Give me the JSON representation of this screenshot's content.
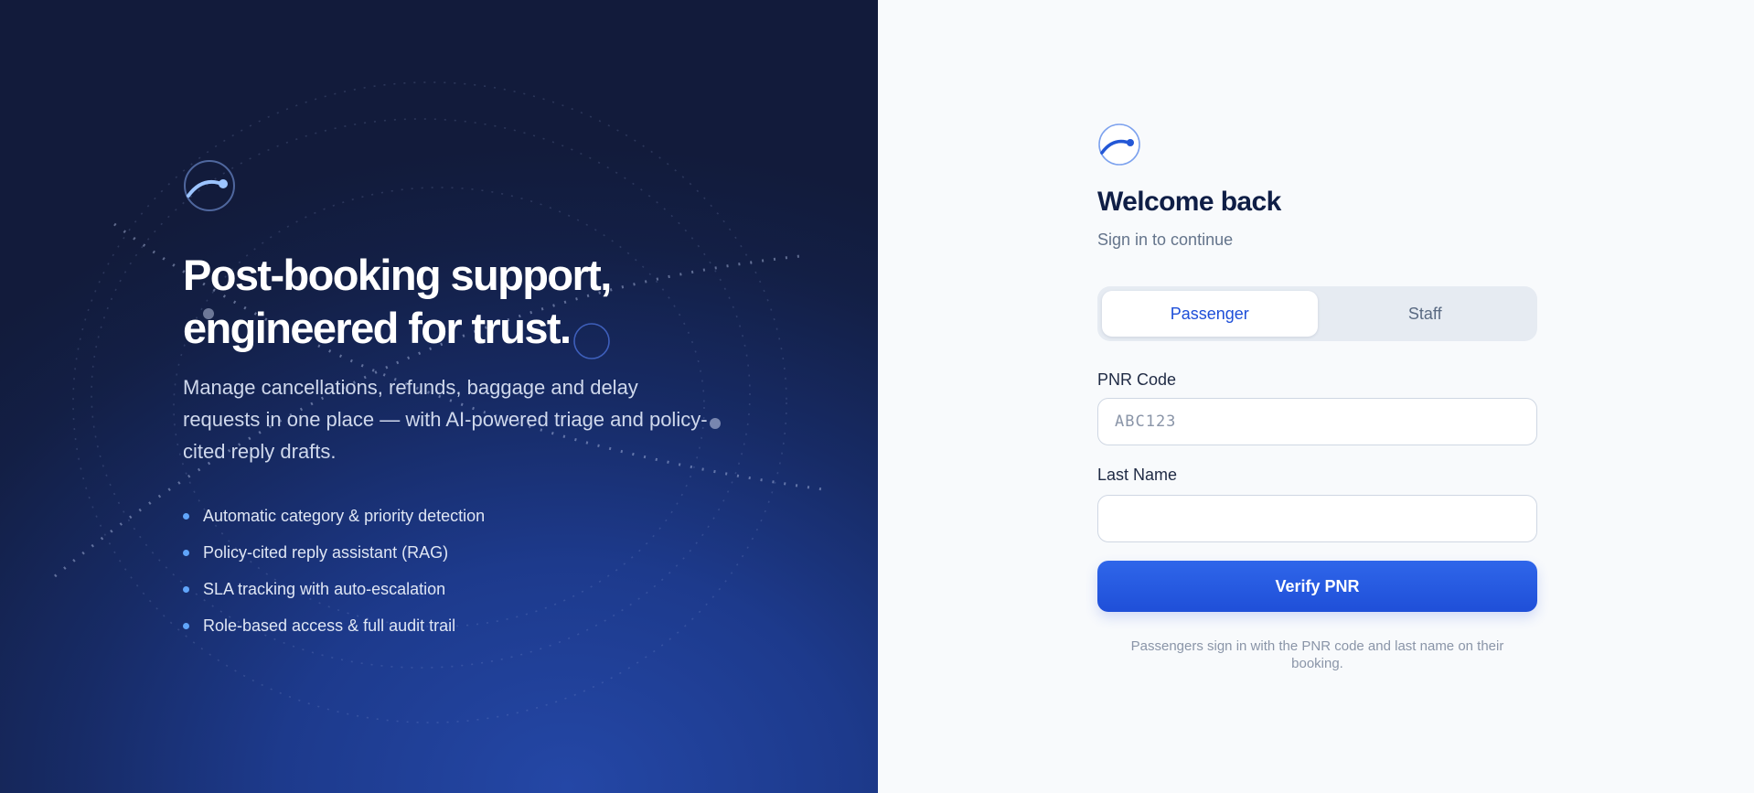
{
  "hero": {
    "logo_icon": "gauge-arc-icon",
    "title_line1": "Post-booking support,",
    "title_line2": "engineered for trust.",
    "description": "Manage cancellations, refunds, baggage and delay requests in one place — with AI-powered triage and policy-cited reply drafts.",
    "features": [
      "Automatic category & priority detection",
      "Policy-cited reply assistant (RAG)",
      "SLA tracking with auto-escalation",
      "Role-based access & full audit trail"
    ],
    "bullet_icon": "bullet-dot-icon"
  },
  "signin": {
    "logo_icon": "gauge-arc-icon",
    "title": "Welcome back",
    "subtitle": "Sign in to continue",
    "tabs": [
      {
        "label": "Passenger",
        "active": true
      },
      {
        "label": "Staff",
        "active": false
      }
    ],
    "pnr": {
      "label": "PNR Code",
      "placeholder": "ABC123",
      "value": ""
    },
    "last_name": {
      "label": "Last Name",
      "placeholder": "",
      "value": ""
    },
    "submit_label": "Verify PNR",
    "hint": "Passengers sign in with the PNR code and last name on their booking."
  },
  "colors": {
    "accent": "#1d4ed8",
    "button": "#2659e0",
    "hero_dark": "#121b3b",
    "hero_blue": "#2447a6",
    "bullet": "#60a5fa"
  }
}
